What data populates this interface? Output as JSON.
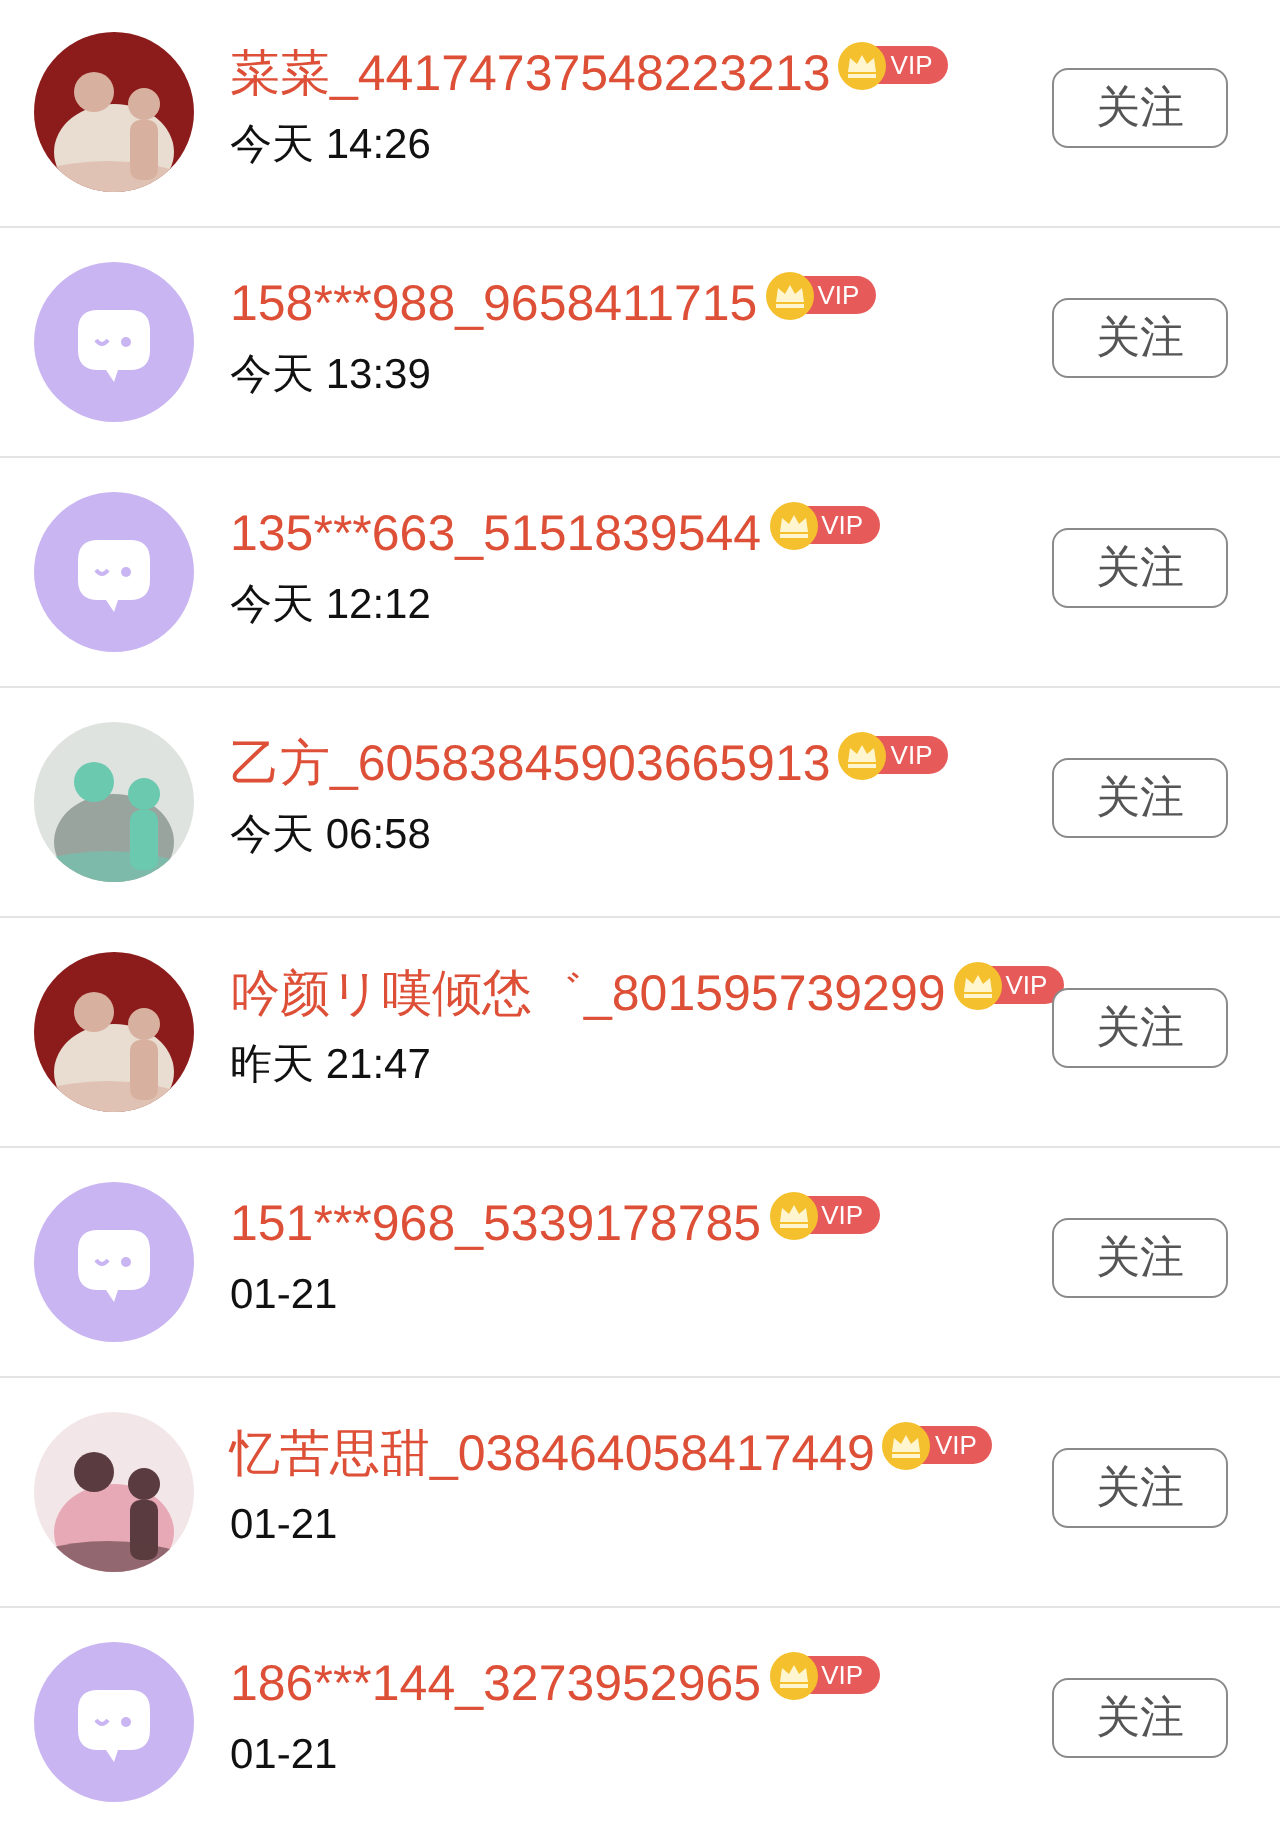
{
  "users": [
    {
      "name": "菜菜_44174737548223213",
      "vip_badge": "VIP",
      "time": "今天 14:26",
      "button": "关注"
    },
    {
      "avatar": {
        "kind": "default"
      },
      "name": "158***988_9658411715",
      "vip_badge": "VIP",
      "time": "今天 13:39",
      "button": "关注"
    },
    {
      "avatar": {
        "kind": "default"
      },
      "name": "135***663_5151839544",
      "vip_badge": "VIP",
      "time": "今天 12:12",
      "button": "关注"
    },
    {
      "name": "乙方_60583845903665913",
      "vip_badge": "VIP",
      "time": "今天 06:58",
      "button": "关注"
    },
    {
      "name": "吟颜リ嘆倾恷゛_801595739299",
      "vip_badge": "VIP",
      "time": "昨天 21:47",
      "button": "关注"
    },
    {
      "avatar": {
        "kind": "default"
      },
      "name": "151***968_5339178785",
      "vip_badge": "VIP",
      "time": "01-21",
      "button": "关注"
    },
    {
      "name": "忆苦思甜_038464058417449",
      "vip_badge": "VIP",
      "time": "01-21",
      "button": "关注"
    },
    {
      "avatar": {
        "kind": "default"
      },
      "name": "186***144_3273952965",
      "vip_badge": "VIP",
      "time": "01-21",
      "button": "关注"
    }
  ]
}
